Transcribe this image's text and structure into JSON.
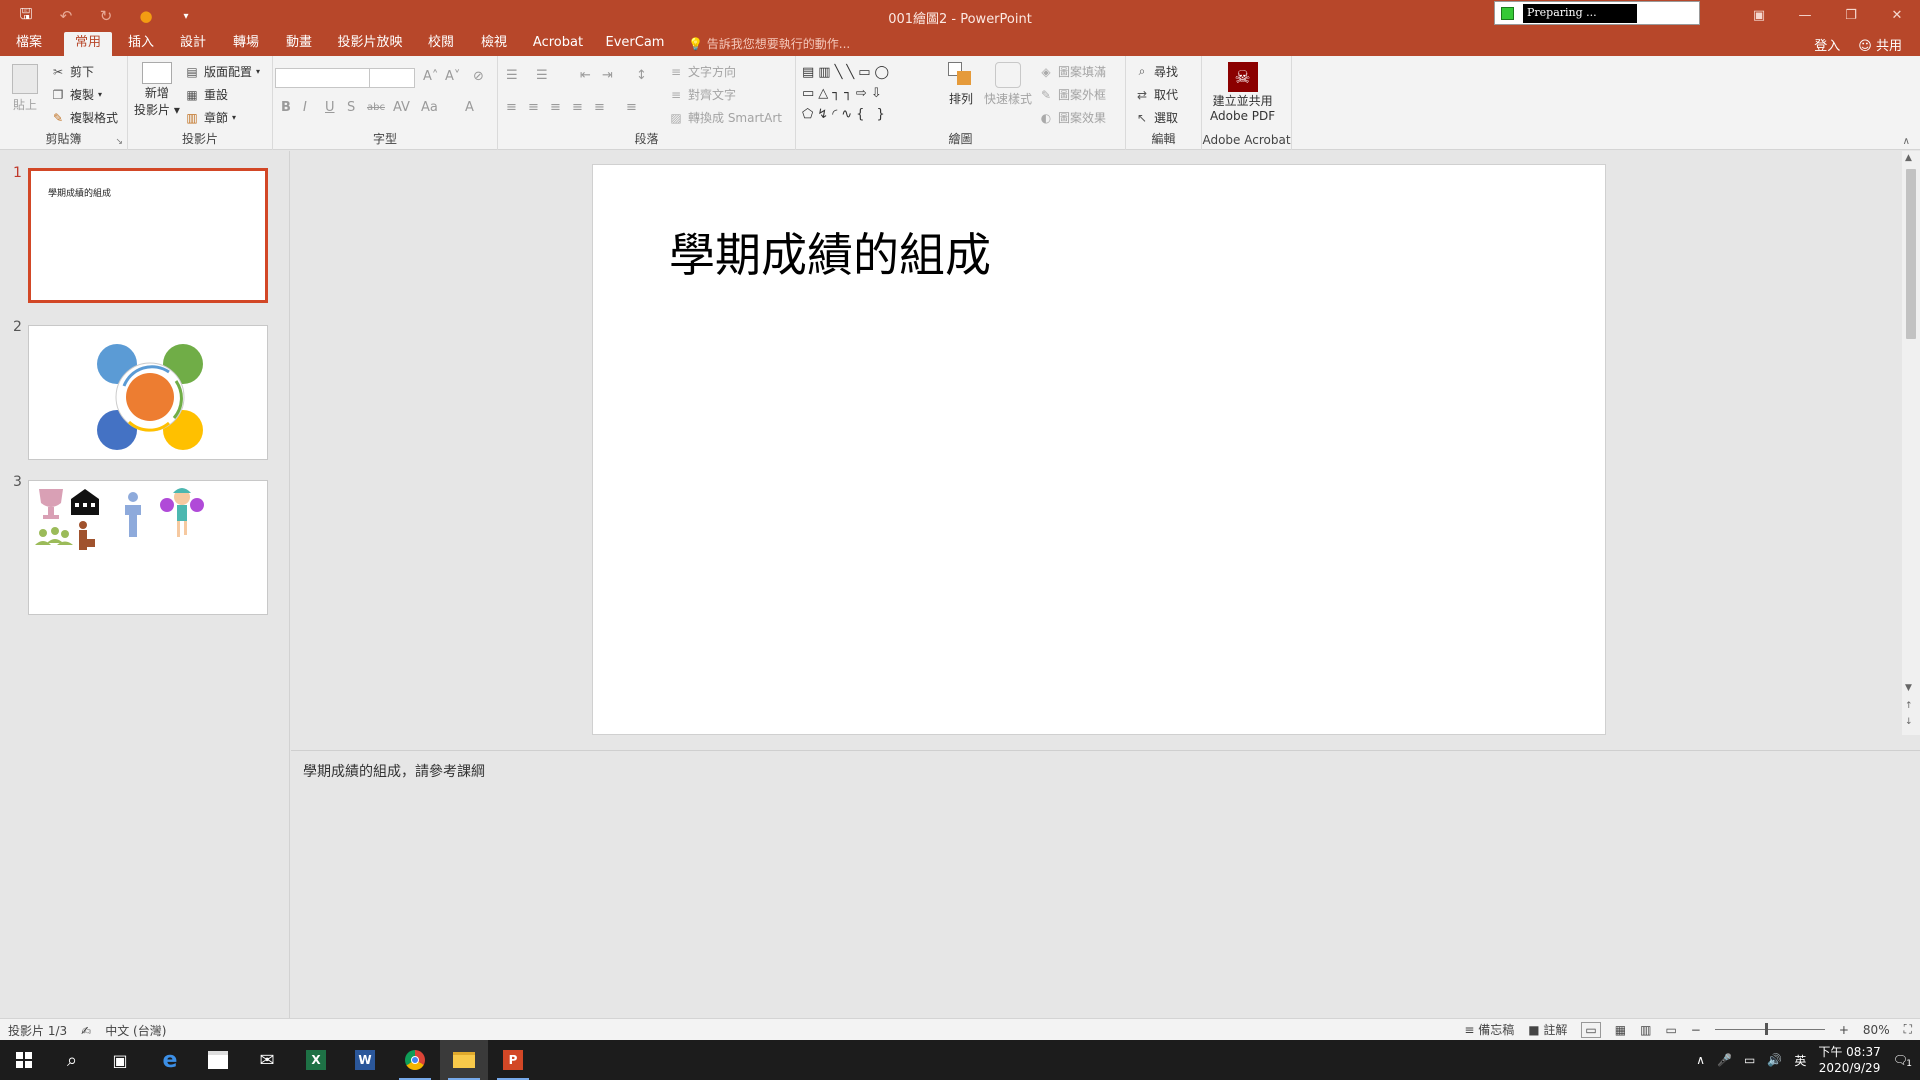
{
  "window": {
    "title": "001繪圖2 - PowerPoint",
    "preparing": "Preparing ..."
  },
  "tabs": [
    {
      "label": "檔案"
    },
    {
      "label": "常用"
    },
    {
      "label": "插入"
    },
    {
      "label": "設計"
    },
    {
      "label": "轉場"
    },
    {
      "label": "動畫"
    },
    {
      "label": "投影片放映"
    },
    {
      "label": "校閱"
    },
    {
      "label": "檢視"
    },
    {
      "label": "Acrobat"
    },
    {
      "label": "EverCam"
    }
  ],
  "tell_me": "告訴我您想要執行的動作...",
  "account": {
    "signin": "登入",
    "share": "共用"
  },
  "ribbon": {
    "clipboard": {
      "paste": "貼上",
      "cut": "剪下",
      "copy": "複製",
      "format_painter": "複製格式",
      "label": "剪貼簿"
    },
    "slides": {
      "new_slide_1": "新增",
      "new_slide_2": "投影片",
      "layout": "版面配置",
      "reset": "重設",
      "section": "章節",
      "label": "投影片"
    },
    "font": {
      "label": "字型"
    },
    "paragraph": {
      "text_direction": "文字方向",
      "align_text": "對齊文字",
      "convert_smartart": "轉換成 SmartArt",
      "label": "段落"
    },
    "drawing": {
      "arrange": "排列",
      "quick_styles": "快速樣式",
      "shape_fill": "圖案填滿",
      "shape_outline": "圖案外框",
      "shape_effects": "圖案效果",
      "label": "繪圖"
    },
    "editing": {
      "find": "尋找",
      "replace": "取代",
      "select": "選取",
      "label": "編輯"
    },
    "acrobat": {
      "create_1": "建立並共用",
      "create_2": "Adobe PDF",
      "label": "Adobe Acrobat"
    }
  },
  "thumbnails": [
    {
      "number": "1",
      "title": "學期成績的組成"
    },
    {
      "number": "2"
    },
    {
      "number": "3"
    }
  ],
  "slide": {
    "title": "學期成績的組成"
  },
  "notes": {
    "text": "學期成績的組成，請參考課綱"
  },
  "status": {
    "slide_info": "投影片 1/3",
    "language": "中文 (台灣)",
    "notes_btn": "備忘稿",
    "comments_btn": "註解",
    "zoom": "80%"
  },
  "tray": {
    "ime": "英",
    "time": "下午 08:37",
    "date": "2020/9/29",
    "notification_count": "1"
  }
}
